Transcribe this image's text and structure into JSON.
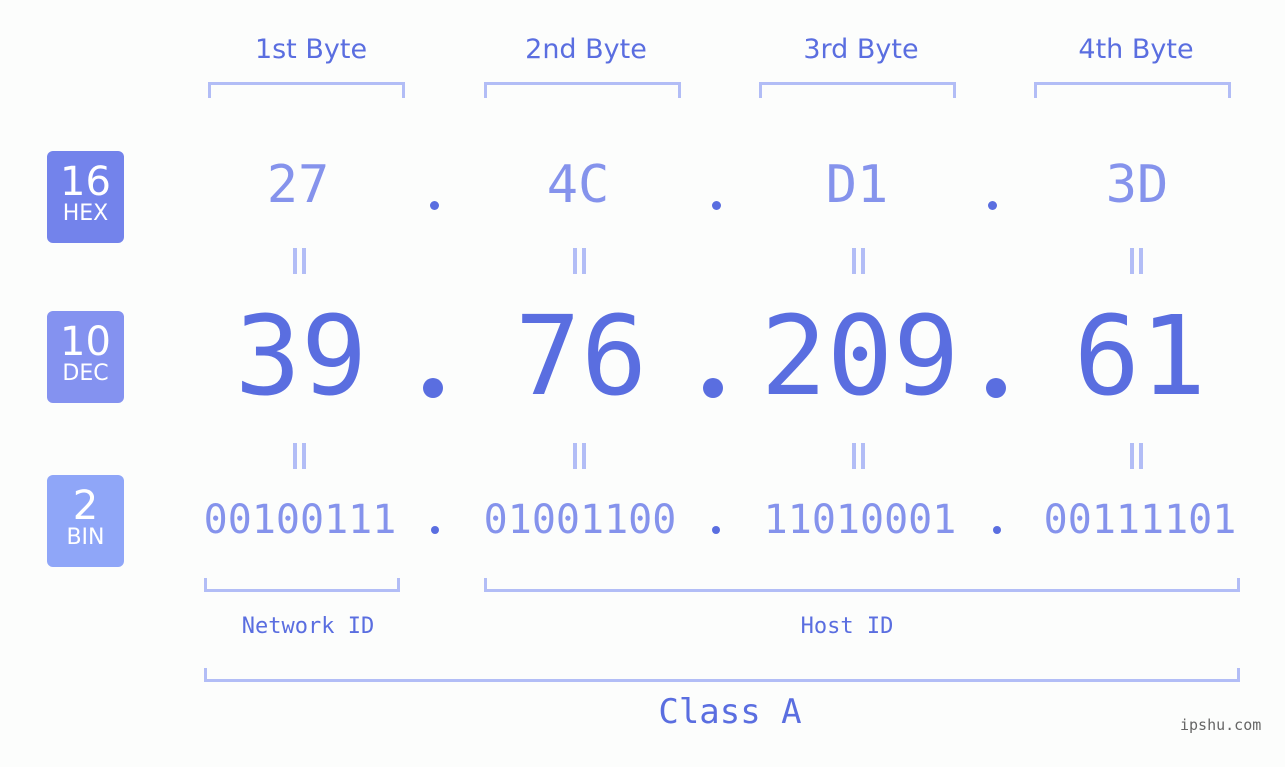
{
  "bytes": [
    {
      "label": "1st Byte",
      "hex": "27",
      "dec": "39",
      "bin": "00100111"
    },
    {
      "label": "2nd Byte",
      "hex": "4C",
      "dec": "76",
      "bin": "01001100"
    },
    {
      "label": "3rd Byte",
      "hex": "D1",
      "dec": "209",
      "bin": "11010001"
    },
    {
      "label": "4th Byte",
      "hex": "3D",
      "dec": "61",
      "bin": "00111101"
    }
  ],
  "badges": {
    "hex": {
      "num": "16",
      "name": "HEX",
      "color": "#7383eb"
    },
    "dec": {
      "num": "10",
      "name": "DEC",
      "color": "#8492f0"
    },
    "bin": {
      "num": "2",
      "name": "BIN",
      "color": "#8fa6f8"
    }
  },
  "separator": ".",
  "network_id_label": "Network ID",
  "host_id_label": "Host ID",
  "class_label": "Class A",
  "watermark": "ipshu.com",
  "colors": {
    "primary": "#5a6ee0",
    "light": "#8593ec",
    "bracket": "#b2bdf6"
  }
}
